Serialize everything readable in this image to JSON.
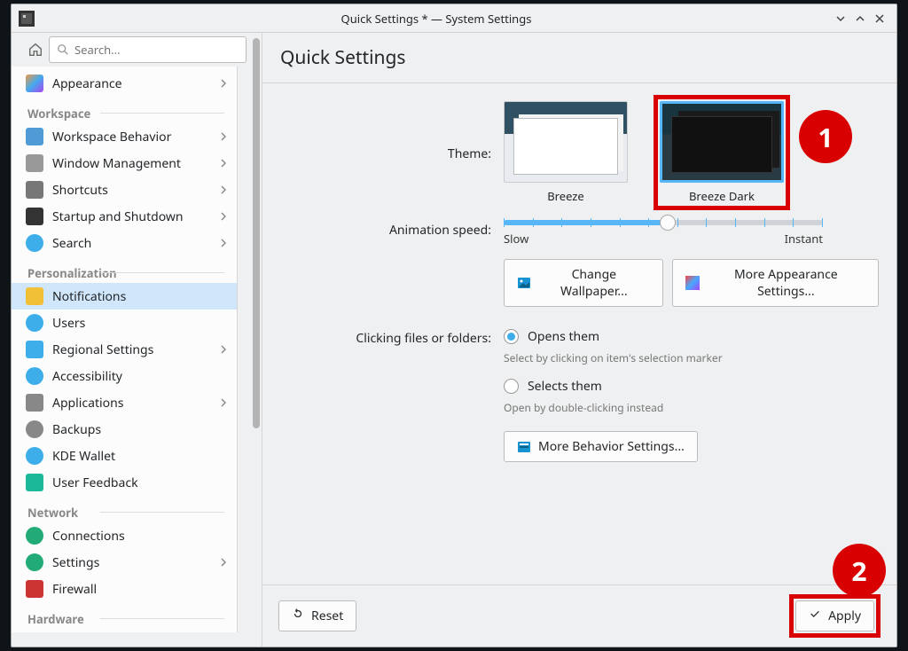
{
  "window_title": "Quick Settings * — System Settings",
  "search": {
    "placeholder": "Search..."
  },
  "page_title": "Quick Settings",
  "sidebar": {
    "items": [
      {
        "label": "Appearance",
        "chevron": true,
        "icon": "ic-appearance"
      }
    ],
    "sections": [
      {
        "title": "Workspace",
        "items": [
          {
            "label": "Workspace Behavior",
            "chevron": true,
            "icon": "ic-workspace"
          },
          {
            "label": "Window Management",
            "chevron": true,
            "icon": "ic-window"
          },
          {
            "label": "Shortcuts",
            "chevron": true,
            "icon": "ic-shortcut"
          },
          {
            "label": "Startup and Shutdown",
            "chevron": true,
            "icon": "ic-startup"
          },
          {
            "label": "Search",
            "chevron": true,
            "icon": "ic-search"
          }
        ]
      },
      {
        "title": "Personalization",
        "items": [
          {
            "label": "Notifications",
            "chevron": false,
            "icon": "ic-notif",
            "selected": true
          },
          {
            "label": "Users",
            "chevron": false,
            "icon": "ic-users"
          },
          {
            "label": "Regional Settings",
            "chevron": true,
            "icon": "ic-regional"
          },
          {
            "label": "Accessibility",
            "chevron": false,
            "icon": "ic-access"
          },
          {
            "label": "Applications",
            "chevron": true,
            "icon": "ic-apps"
          },
          {
            "label": "Backups",
            "chevron": false,
            "icon": "ic-backup"
          },
          {
            "label": "KDE Wallet",
            "chevron": false,
            "icon": "ic-wallet"
          },
          {
            "label": "User Feedback",
            "chevron": false,
            "icon": "ic-feedback"
          }
        ]
      },
      {
        "title": "Network",
        "items": [
          {
            "label": "Connections",
            "chevron": false,
            "icon": "ic-conn"
          },
          {
            "label": "Settings",
            "chevron": true,
            "icon": "ic-netset"
          },
          {
            "label": "Firewall",
            "chevron": false,
            "icon": "ic-firewall"
          }
        ]
      },
      {
        "title": "Hardware",
        "items": []
      }
    ]
  },
  "theme": {
    "label": "Theme:",
    "options": [
      {
        "name": "Breeze",
        "selected": false
      },
      {
        "name": "Breeze Dark",
        "selected": true
      }
    ]
  },
  "animation": {
    "label": "Animation speed:",
    "min_label": "Slow",
    "max_label": "Instant"
  },
  "buttons": {
    "change_wallpaper": "Change Wallpaper...",
    "more_appearance": "More Appearance Settings...",
    "more_behavior": "More Behavior Settings...",
    "reset": "Reset",
    "apply": "Apply"
  },
  "clicking": {
    "label": "Clicking files or folders:",
    "opens": "Opens them",
    "opens_hint": "Select by clicking on item's selection marker",
    "selects": "Selects them",
    "selects_hint": "Open by double-clicking instead"
  },
  "callouts": {
    "one": "1",
    "two": "2"
  }
}
